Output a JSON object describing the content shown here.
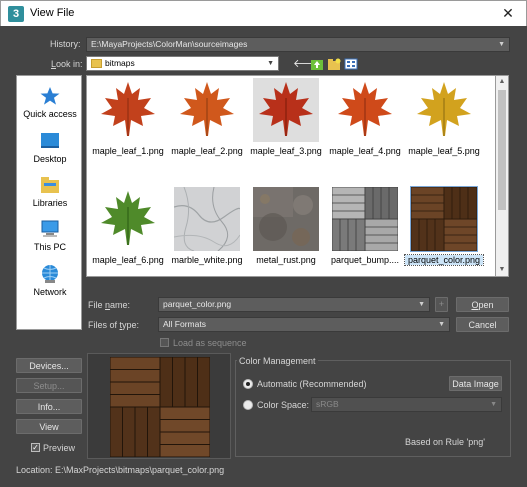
{
  "window": {
    "title": "View File",
    "app_icon_glyph": "3",
    "close_glyph": "✕"
  },
  "history": {
    "label": "History:",
    "value": "E:\\MayaProjects\\ColorMan\\sourceimages"
  },
  "lookin": {
    "label": "Look in:",
    "value": "bitmaps"
  },
  "sidebar": {
    "items": [
      {
        "label": "Quick access",
        "icon": "star-icon"
      },
      {
        "label": "Desktop",
        "icon": "desktop-icon"
      },
      {
        "label": "Libraries",
        "icon": "libraries-icon"
      },
      {
        "label": "This PC",
        "icon": "computer-icon"
      },
      {
        "label": "Network",
        "icon": "network-icon"
      }
    ]
  },
  "files": [
    {
      "name": "maple_leaf_1.png",
      "kind": "leaf",
      "color": "#c2411c",
      "bg": "#ffffff"
    },
    {
      "name": "maple_leaf_2.png",
      "kind": "leaf",
      "color": "#d0581c",
      "bg": "#ffffff"
    },
    {
      "name": "maple_leaf_3.png",
      "kind": "leaf",
      "color": "#b8301a",
      "bg": "#dedede"
    },
    {
      "name": "maple_leaf_4.png",
      "kind": "leaf",
      "color": "#cf4a1a",
      "bg": "#ffffff"
    },
    {
      "name": "maple_leaf_5.png",
      "kind": "leaf",
      "color": "#d2a21e",
      "bg": "#ffffff"
    },
    {
      "name": "maple_leaf_6.png",
      "kind": "leaf",
      "color": "#4f8a2a",
      "bg": "#ffffff"
    },
    {
      "name": "marble_white.png",
      "kind": "marble"
    },
    {
      "name": "metal_rust.png",
      "kind": "metal"
    },
    {
      "name": "parquet_bump....",
      "kind": "parquet_bw"
    },
    {
      "name": "parquet_color.png",
      "kind": "parquet",
      "selected": true
    }
  ],
  "filename": {
    "label": "File name:",
    "value": "parquet_color.png"
  },
  "filetype": {
    "label": "Files of type:",
    "value": "All Formats"
  },
  "load_sequence": {
    "label": "Load as sequence"
  },
  "buttons": {
    "open": "Open",
    "cancel": "Cancel",
    "plus": "+",
    "devices": "Devices...",
    "setup": "Setup...",
    "info": "Info...",
    "view": "View",
    "data_image": "Data Image"
  },
  "preview": {
    "label": "Preview",
    "checked": true
  },
  "color_management": {
    "title": "Color Management",
    "automatic_label": "Automatic (Recommended)",
    "colorspace_label": "Color Space:",
    "colorspace_value": "sRGB",
    "rule_text": "Based on Rule 'png'"
  },
  "location": {
    "label": "Location:",
    "value": "E:\\MaxProjects\\bitmaps\\parquet_color.png"
  },
  "colors": {
    "dialog_bg": "#444444",
    "selection": "#cce4f7",
    "accent": "#2f8f9c"
  }
}
